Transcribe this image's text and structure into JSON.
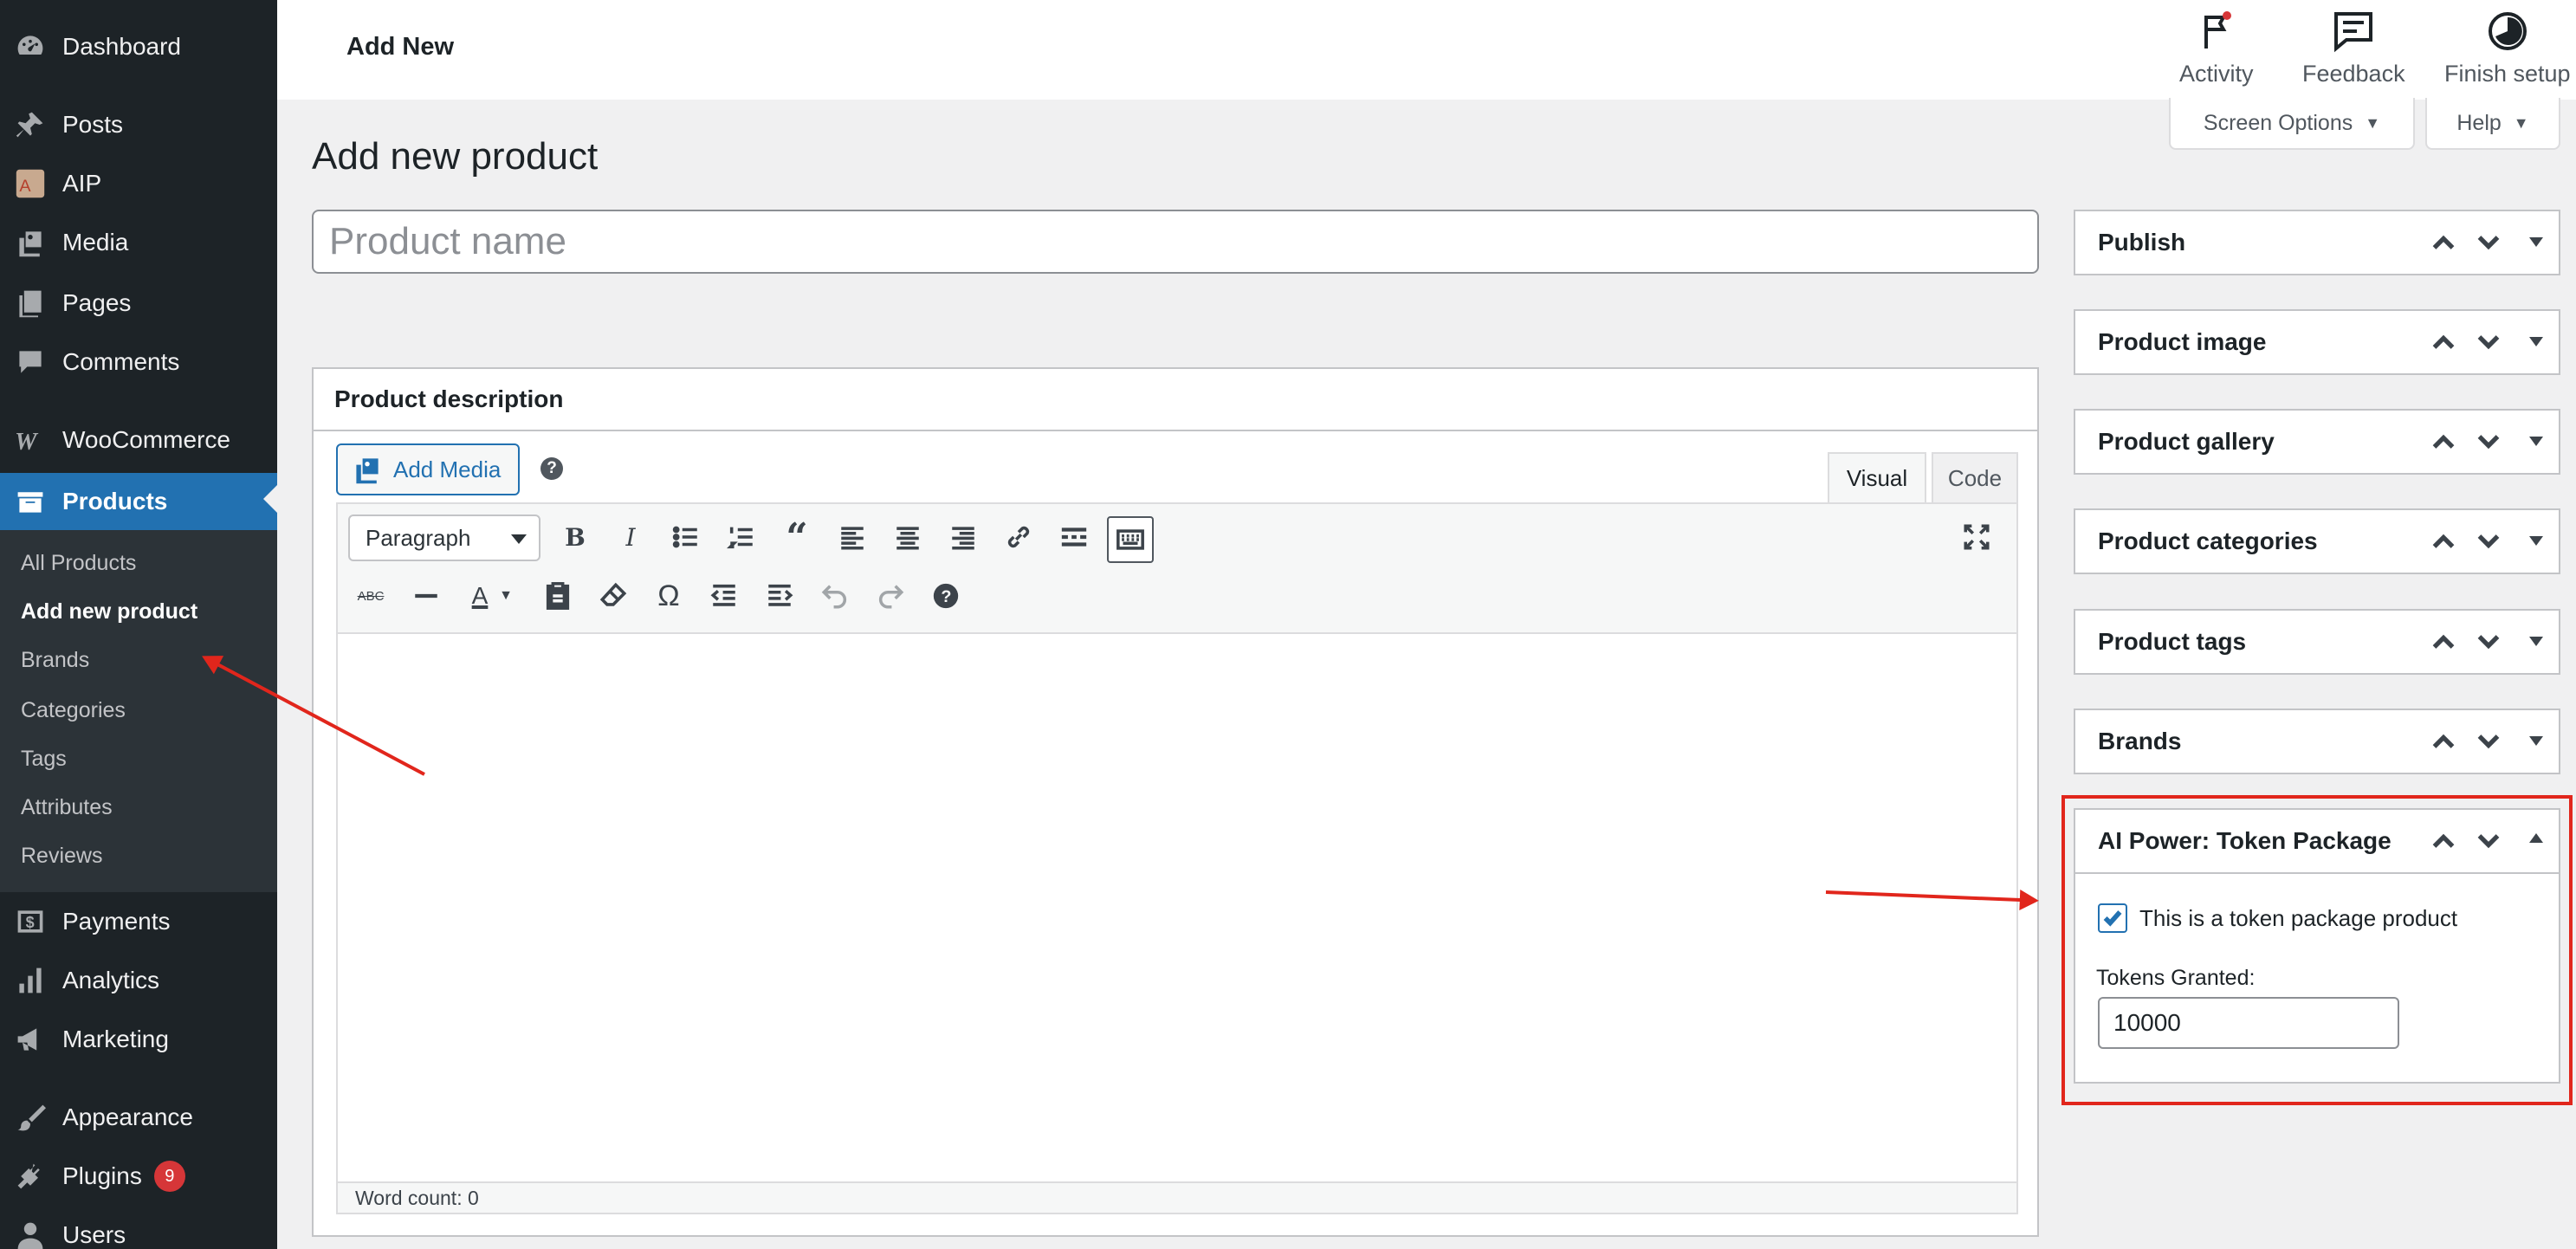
{
  "sidebar": {
    "items": [
      {
        "label": "Dashboard",
        "icon": "dashboard-icon"
      },
      {
        "label": "Posts",
        "icon": "pin-icon"
      },
      {
        "label": "AIP",
        "icon": "aip-logo-icon"
      },
      {
        "label": "Media",
        "icon": "media-icon"
      },
      {
        "label": "Pages",
        "icon": "pages-icon"
      },
      {
        "label": "Comments",
        "icon": "comment-icon"
      },
      {
        "label": "WooCommerce",
        "icon": "woocommerce-icon"
      },
      {
        "label": "Products",
        "icon": "products-icon"
      },
      {
        "label": "Payments",
        "icon": "payments-icon"
      },
      {
        "label": "Analytics",
        "icon": "analytics-icon"
      },
      {
        "label": "Marketing",
        "icon": "megaphone-icon"
      },
      {
        "label": "Appearance",
        "icon": "brush-icon"
      },
      {
        "label": "Plugins",
        "icon": "plugin-icon",
        "badge": "9"
      },
      {
        "label": "Users",
        "icon": "users-icon"
      }
    ],
    "submenu": [
      "All Products",
      "Add new product",
      "Brands",
      "Categories",
      "Tags",
      "Attributes",
      "Reviews"
    ]
  },
  "topbar": {
    "title": "Add New",
    "activity": "Activity",
    "feedback": "Feedback",
    "finish": "Finish setup",
    "screen_options": "Screen Options",
    "help": "Help"
  },
  "main": {
    "heading": "Add new product",
    "title_placeholder": "Product name",
    "title_value": ""
  },
  "description": {
    "heading": "Product description",
    "add_media": "Add Media",
    "tab_visual": "Visual",
    "tab_code": "Code",
    "format": "Paragraph",
    "word_count": "Word count: 0"
  },
  "metaboxes": [
    "Publish",
    "Product image",
    "Product gallery",
    "Product categories",
    "Product tags",
    "Brands"
  ],
  "token_package": {
    "title": "AI Power: Token Package",
    "checkbox_label": "This is a token package product",
    "checked": true,
    "tokens_label": "Tokens Granted:",
    "tokens_value": "10000"
  },
  "colors": {
    "accent": "#2271b1",
    "sidebar": "#1d2327",
    "highlight": "#e1261c",
    "badge": "#d63638"
  }
}
